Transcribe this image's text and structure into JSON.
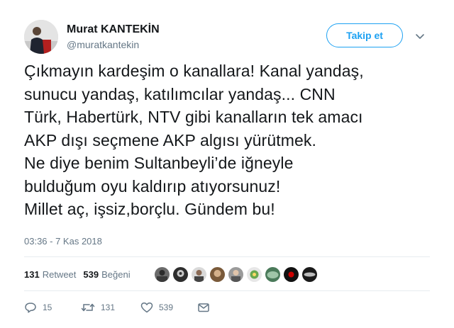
{
  "user": {
    "display_name": "Murat KANTEKİN",
    "handle": "@muratkantekin"
  },
  "follow_button_label": "Takip et",
  "tweet": {
    "lines": [
      "Çıkmayın kardeşim o kanallara! Kanal yandaş,",
      "sunucu yandaş, katılımcılar yandaş... CNN",
      "Türk, Habertürk, NTV gibi kanalların tek amacı",
      "AKP dışı seçmene AKP algısı yürütmek.",
      "Ne diye benim Sultanbeyli’de iğneyle",
      "bulduğum oyu kaldırıp atıyorsunuz!",
      "Millet aç, işsiz,borçlu. Gündem bu!"
    ],
    "timestamp": "03:36 - 7 Kas 2018"
  },
  "stats": {
    "retweets": "131",
    "retweet_label": "Retweet",
    "likes": "539",
    "like_label": "Beğeni"
  },
  "actions": {
    "reply_count": "15",
    "retweet_count": "131",
    "like_count": "539"
  },
  "icons": [
    "chevron-down-icon",
    "reply-icon",
    "retweet-icon",
    "heart-icon",
    "envelope-icon"
  ],
  "colors": {
    "accent": "#1da1f2",
    "muted": "#657786",
    "text": "#14171a",
    "divider": "#e6ecf0"
  }
}
